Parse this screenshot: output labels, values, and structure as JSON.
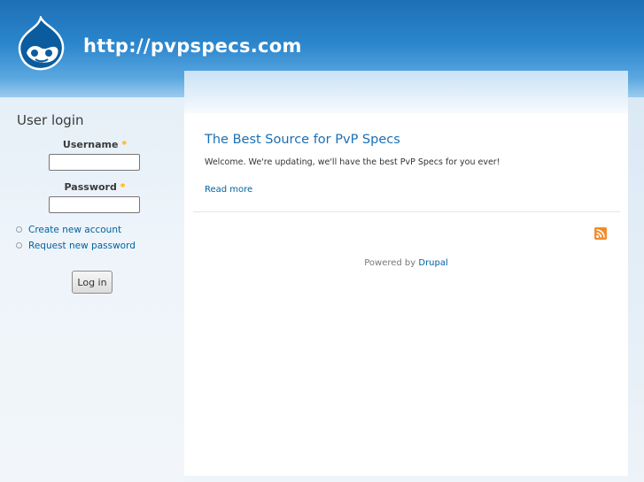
{
  "header": {
    "site_title": "http://pvpspecs.com"
  },
  "sidebar": {
    "block_title": "User login",
    "username_label": "Username",
    "password_label": "Password",
    "required_marker": "*",
    "links": [
      "Create new account",
      "Request new password"
    ],
    "login_button": "Log in"
  },
  "node": {
    "title": "The Best Source for PvP Specs",
    "body": "Welcome. We're updating, we'll have the best PvP Specs for you ever!",
    "read_more": "Read more"
  },
  "footer": {
    "powered_by": "Powered by",
    "drupal_link": "Drupal"
  },
  "colors": {
    "header_blue": "#2b86cc",
    "link": "#0062a0",
    "rss": "#f48b2a"
  },
  "icons": {
    "logo": "drupal-drop-logo",
    "feed": "rss-feed-icon"
  }
}
